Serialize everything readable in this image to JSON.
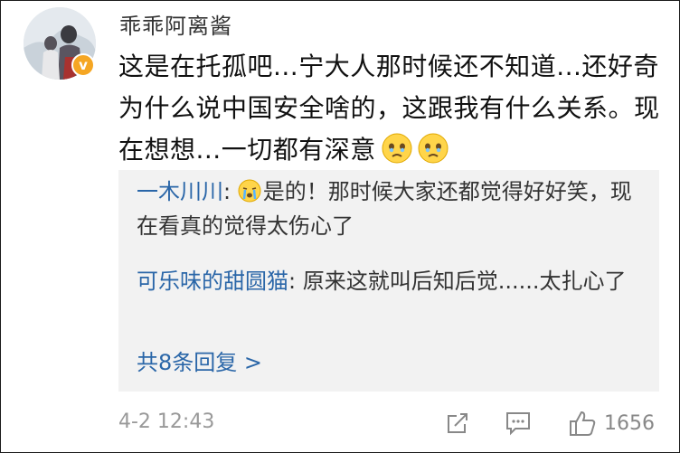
{
  "comment": {
    "username": "乖乖阿离酱",
    "verified_badge": "v",
    "text": "这是在托孤吧...宁大人那时候还不知道...还好奇为什么说中国安全啥的，这跟我有什么关系。现在想想...一切都有深意",
    "emojis": [
      "sad-face-icon",
      "sad-face-icon"
    ],
    "time": "4-2 12:43",
    "like_count": "1656"
  },
  "replies": [
    {
      "name": "一木川川",
      "separator": ":",
      "emoji": "crying-face-icon",
      "text": "是的！那时候大家还都觉得好好笑，现在看真的觉得太伤心了"
    },
    {
      "name": "可乐味的甜圆猫",
      "separator": ":",
      "text": "原来这就叫后知后觉......太扎心了"
    }
  ],
  "more_replies_label": "共8条回复 >",
  "actions": [
    "share-icon",
    "comment-icon",
    "like-icon"
  ],
  "colors": {
    "link": "#2a66a8",
    "badge": "#f5a623",
    "reply_bg": "#f2f2f2",
    "meta": "#999999"
  }
}
